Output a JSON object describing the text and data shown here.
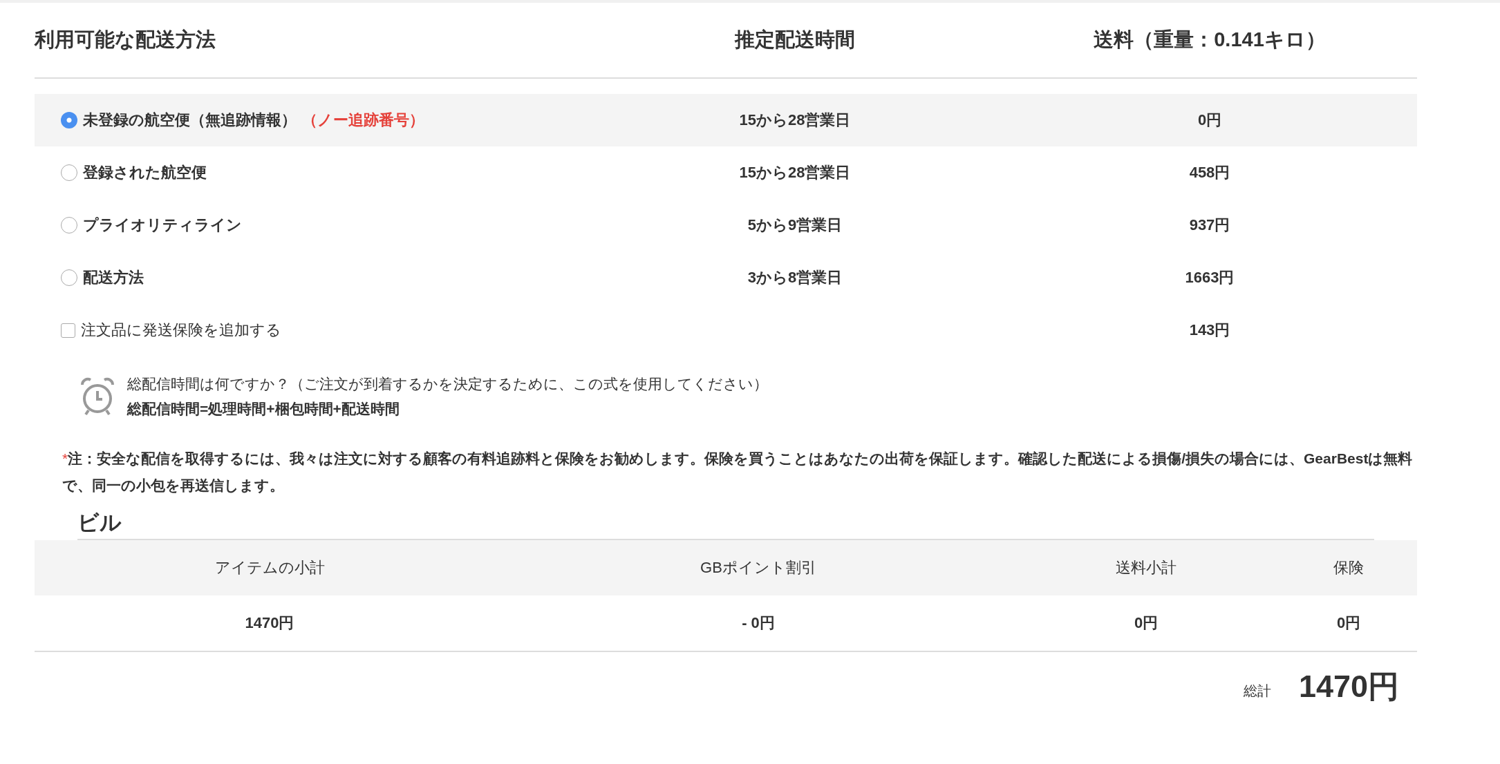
{
  "shipping": {
    "columns": [
      "利用可能な配送方法",
      "推定配送時間",
      "送料（重量：0.141キロ）"
    ],
    "methods": [
      {
        "name": "未登録の航空便（無追跡情報）",
        "tag": "（ノー追跡番号）",
        "time": "15から28営業日",
        "cost": "0円",
        "selected": true
      },
      {
        "name": "登録された航空便",
        "time": "15から28営業日",
        "cost": "458円",
        "selected": false
      },
      {
        "name": "プライオリティライン",
        "time": "5から9営業日",
        "cost": "937円",
        "selected": false
      },
      {
        "name": "配送方法",
        "time": "3から8営業日",
        "cost": "1663円",
        "selected": false
      }
    ],
    "insurance": {
      "label": "注文品に発送保険を追加する",
      "cost": "143円",
      "checked": false
    },
    "note": {
      "question": "総配信時間は何ですか？（ご注文が到着するかを決定するために、この式を使用してください）",
      "formula": "総配信時間=処理時間+梱包時間+配送時間"
    },
    "warning": {
      "mark": "*",
      "text": "注：安全な配信を取得するには、我々は注文に対する顧客の有料追跡料と保険をお勧めします。保険を買うことはあなたの出荷を保証します。確認した配送による損傷/損失の場合には、GearBestは無料で、同一の小包を再送信します。"
    }
  },
  "bill": {
    "title": "ビル",
    "columns": [
      "アイテムの小計",
      "GBポイント割引",
      "送料小計",
      "保険"
    ],
    "values": [
      "1470円",
      "- 0円",
      "0円",
      "0円"
    ],
    "total_label": "総計",
    "total": "1470円"
  }
}
